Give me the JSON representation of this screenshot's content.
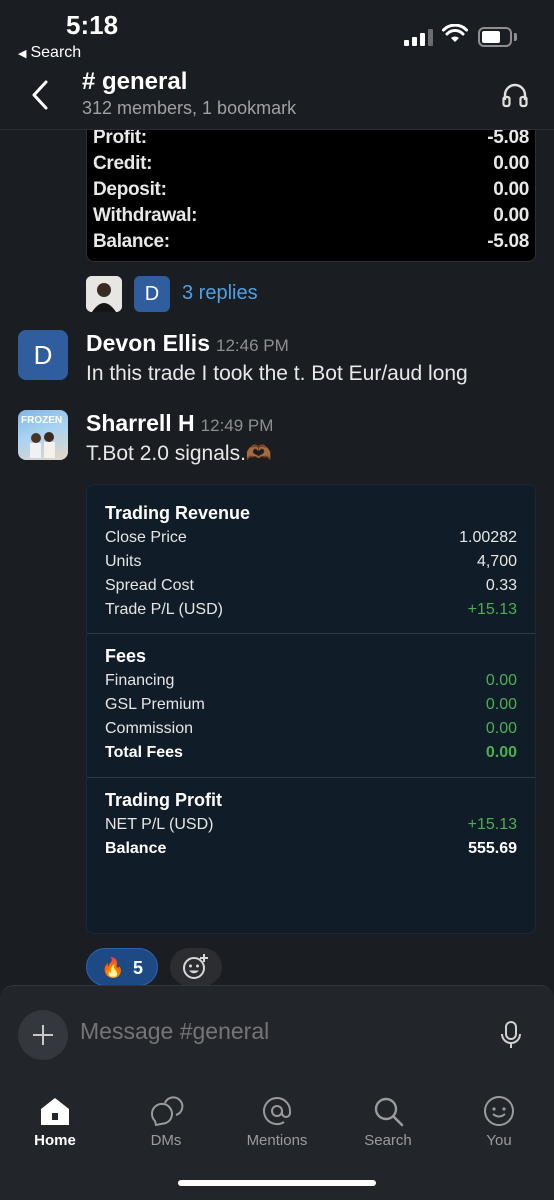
{
  "status_bar": {
    "time": "5:18",
    "back_label": "Search"
  },
  "header": {
    "title": "# general",
    "subtitle": "312 members, 1 bookmark"
  },
  "account_card": {
    "rows": [
      {
        "label": "Profit:",
        "value": "-5.08"
      },
      {
        "label": "Credit:",
        "value": "0.00"
      },
      {
        "label": "Deposit:",
        "value": "0.00"
      },
      {
        "label": "Withdrawal:",
        "value": "0.00"
      },
      {
        "label": "Balance:",
        "value": "-5.08"
      }
    ]
  },
  "thread": {
    "reply_avatar_letter": "D",
    "replies_label": "3 replies"
  },
  "messages": [
    {
      "author": "Devon Ellis",
      "time": "12:46 PM",
      "avatar_letter": "D",
      "text": "In this trade I took the t. Bot Eur/aud long"
    },
    {
      "author": "Sharrell H",
      "time": "12:49 PM",
      "avatar_text": "FROZEN",
      "text": "T.Bot 2.0 signals.🫶🏾"
    }
  ],
  "trade_card": {
    "revenue": {
      "title": "Trading Revenue",
      "rows": [
        {
          "label": "Close Price",
          "value": "1.00282"
        },
        {
          "label": "Units",
          "value": "4,700"
        },
        {
          "label": "Spread Cost",
          "value": "0.33"
        },
        {
          "label": "Trade P/L (USD)",
          "value": "+15.13"
        }
      ]
    },
    "fees": {
      "title": "Fees",
      "rows": [
        {
          "label": "Financing",
          "value": "0.00"
        },
        {
          "label": "GSL Premium",
          "value": "0.00"
        },
        {
          "label": "Commission",
          "value": "0.00"
        },
        {
          "label": "Total Fees",
          "value": "0.00"
        }
      ]
    },
    "profit": {
      "title": "Trading Profit",
      "rows": [
        {
          "label": "NET P/L (USD)",
          "value": "+15.13"
        },
        {
          "label": "Balance",
          "value": "555.69"
        }
      ]
    }
  },
  "reactions": {
    "fire_emoji": "🔥",
    "fire_count": "5"
  },
  "composer": {
    "placeholder": "Message #general"
  },
  "tabs": [
    {
      "label": "Home",
      "icon": "home-icon"
    },
    {
      "label": "DMs",
      "icon": "dms-icon"
    },
    {
      "label": "Mentions",
      "icon": "mentions-icon"
    },
    {
      "label": "Search",
      "icon": "search-icon"
    },
    {
      "label": "You",
      "icon": "you-icon"
    }
  ],
  "colors": {
    "accent_link": "#4ea1e4",
    "positive": "#4caf50",
    "avatar_blue": "#2f5d9e",
    "reaction_blue": "#1d4a85"
  }
}
